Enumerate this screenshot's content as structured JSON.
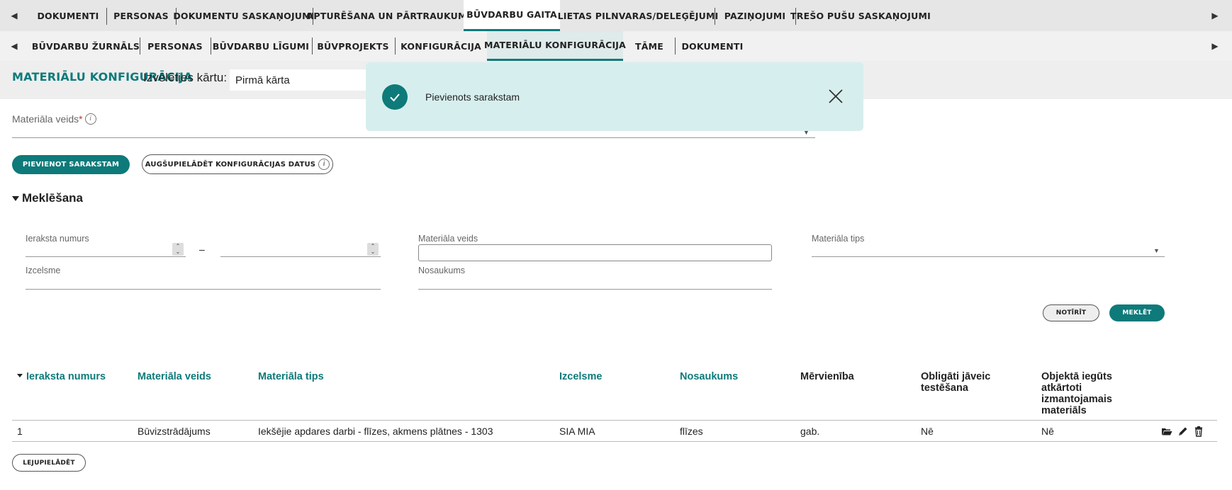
{
  "top_tabs": [
    {
      "label": "DOKUMENTI",
      "active": false
    },
    {
      "label": "PERSONAS",
      "active": false
    },
    {
      "label": "DOKUMENTU SASKAŅOJUMI",
      "active": false
    },
    {
      "label": "APTURĒŠANA UN PĀRTRAUKUMI",
      "active": false
    },
    {
      "label": "BŪVDARBU GAITA",
      "active": true
    },
    {
      "label": "LIETAS PILNVARAS/DELEĢĒJUMI",
      "active": false
    },
    {
      "label": "PAZIŅOJUMI",
      "active": false
    },
    {
      "label": "TREŠO PUŠU SASKAŅOJUMI",
      "active": false
    }
  ],
  "sub_tabs": [
    {
      "label": "BŪVDARBU ŽURNĀLS",
      "active": false
    },
    {
      "label": "PERSONAS",
      "active": false
    },
    {
      "label": "BŪVDARBU LĪGUMI",
      "active": false
    },
    {
      "label": "BŪVPROJEKTS",
      "active": false
    },
    {
      "label": "KONFIGURĀCIJA",
      "active": false
    },
    {
      "label": "MATERIĀLU KONFIGURĀCIJA",
      "active": true
    },
    {
      "label": "TĀME",
      "active": false
    },
    {
      "label": "DOKUMENTI",
      "active": false
    }
  ],
  "header": {
    "title": "MATERIĀLU KONFIGURĀCIJA",
    "choose_label": "Izvēlēties kārtu:",
    "stage_value": "Pirmā kārta"
  },
  "toast": {
    "message": "Pievienots sarakstam"
  },
  "form": {
    "material_type_label": "Materiāla veids",
    "required_mark": "*",
    "add_button": "PIEVIENOT SARAKSTAM",
    "upload_button": "AUGŠUPIELĀDĒT KONFIGURĀCIJAS DATUS"
  },
  "search": {
    "title": "Meklēšana",
    "record_number_label": "Ieraksta numurs",
    "range_dash": "–",
    "material_type_label": "Materiāla veids",
    "material_kind_label": "Materiāla tips",
    "origin_label": "Izcelsme",
    "name_label": "Nosaukums",
    "clear_button": "NOTĪRĪT",
    "search_button": "MEKLĒT"
  },
  "table": {
    "columns": [
      "Ieraksta numurs",
      "Materiāla veids",
      "Materiāla tips",
      "Izcelsme",
      "Nosaukums",
      "Mērvienība",
      "Obligāti jāveic testēšana",
      "Objektā iegūts atkārtoti izmantojamais materiāls"
    ],
    "rows": [
      [
        "1",
        "Būvizstrādājums",
        "Iekšējie apdares darbi - flīzes, akmens plātnes - 1303",
        "SIA MIA",
        "flīzes",
        "gab.",
        "Nē",
        "Nē"
      ]
    ],
    "download_button": "LEJUPIELĀDĒT"
  },
  "colors": {
    "accent": "#0e7a7a",
    "toast_bg": "#d7eeee",
    "nav_bg": "#e6e6e6"
  }
}
